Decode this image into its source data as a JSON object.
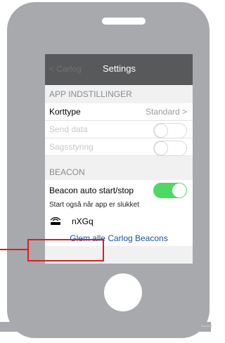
{
  "navbar": {
    "back_label": "< Carlog",
    "title": "Settings"
  },
  "app_settings": {
    "header": "APP INDSTILLINGER",
    "korttype": {
      "label": "Korttype",
      "value": "Standard >"
    },
    "send_data": {
      "label": "Send data",
      "enabled": false,
      "on": false
    },
    "sagsstyring": {
      "label": "Sagsstyring",
      "enabled": false,
      "on": false
    }
  },
  "beacon": {
    "header": "BEACON",
    "auto_start_stop": {
      "label": "Beacon auto start/stop",
      "on": true
    },
    "note": "Start også når app er slukket",
    "device_name": "nXGq",
    "forget_link": "Glem alle Carlog Beacons"
  },
  "colors": {
    "toggle_on": "#4cd964",
    "highlight": "#e11b22",
    "link": "#1c52a3",
    "navbar": "#58595b"
  }
}
